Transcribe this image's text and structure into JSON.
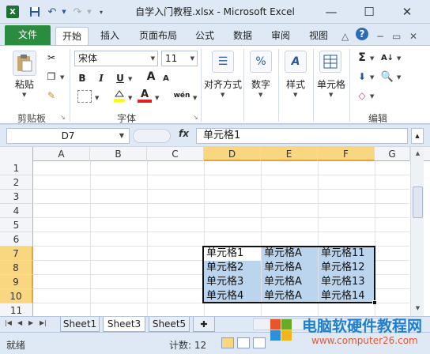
{
  "window": {
    "title": "自学入门教程.xlsx - Microsoft Excel",
    "minimize": "—",
    "maximize": "☐",
    "close": "✕"
  },
  "quick_access": {
    "app_icon": "excel-icon",
    "save": "save-icon",
    "undo": "undo-icon",
    "redo": "redo-icon",
    "customize": "customize-arrow-icon"
  },
  "ribbon_tabs": {
    "file": "文件",
    "tabs": [
      "开始",
      "插入",
      "页面布局",
      "公式",
      "数据",
      "审阅",
      "视图"
    ],
    "active": "开始"
  },
  "ribbon": {
    "clipboard": {
      "label": "剪贴板",
      "paste": "粘贴"
    },
    "font": {
      "label": "字体",
      "font_name": "宋体",
      "font_size": "11",
      "bold": "B",
      "italic": "I",
      "underline": "U",
      "grow": "A",
      "shrink": "A",
      "color_letter": "A",
      "phonetic": "wén"
    },
    "alignment": {
      "label": "对齐方式"
    },
    "number": {
      "label": "数字",
      "icon_text": "%"
    },
    "styles": {
      "label": "样式"
    },
    "cells": {
      "label": "单元格"
    },
    "editing": {
      "label": "编辑",
      "sum": "Σ"
    }
  },
  "formula_bar": {
    "name_box": "D7",
    "fx": "fx",
    "content": "单元格1"
  },
  "columns": [
    "A",
    "B",
    "C",
    "D",
    "E",
    "F",
    "G"
  ],
  "rows": [
    "1",
    "2",
    "3",
    "4",
    "5",
    "6",
    "7",
    "8",
    "9",
    "10",
    "11"
  ],
  "selected_columns": [
    "D",
    "E",
    "F"
  ],
  "selected_rows": [
    "7",
    "8",
    "9",
    "10"
  ],
  "cells": [
    [
      "单元格1",
      "单元格A",
      "单元格11"
    ],
    [
      "单元格2",
      "单元格A",
      "单元格12"
    ],
    [
      "单元格3",
      "单元格A",
      "单元格13"
    ],
    [
      "单元格4",
      "单元格A",
      "单元格14"
    ]
  ],
  "sheets": {
    "tabs": [
      "Sheet1",
      "Sheet3",
      "Sheet5"
    ],
    "active": "Sheet3"
  },
  "status": {
    "mode": "就绪",
    "count": "计数: 12"
  },
  "watermark": {
    "text": "电脑软硬件教程网",
    "url": "www.computer26.com"
  }
}
